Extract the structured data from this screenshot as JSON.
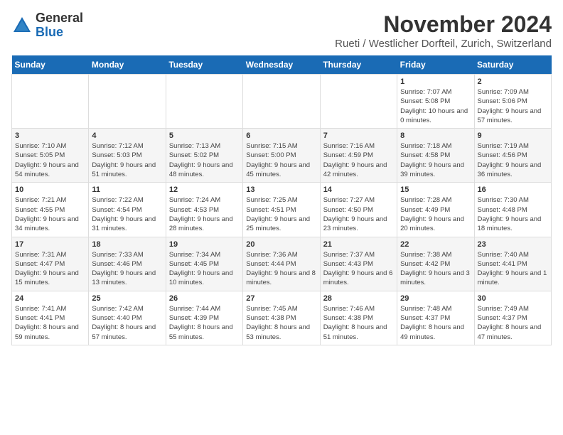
{
  "logo": {
    "general": "General",
    "blue": "Blue"
  },
  "header": {
    "title": "November 2024",
    "subtitle": "Rueti / Westlicher Dorfteil, Zurich, Switzerland"
  },
  "weekdays": [
    "Sunday",
    "Monday",
    "Tuesday",
    "Wednesday",
    "Thursday",
    "Friday",
    "Saturday"
  ],
  "rows": [
    [
      {
        "day": "",
        "info": ""
      },
      {
        "day": "",
        "info": ""
      },
      {
        "day": "",
        "info": ""
      },
      {
        "day": "",
        "info": ""
      },
      {
        "day": "",
        "info": ""
      },
      {
        "day": "1",
        "info": "Sunrise: 7:07 AM\nSunset: 5:08 PM\nDaylight: 10 hours and 0 minutes."
      },
      {
        "day": "2",
        "info": "Sunrise: 7:09 AM\nSunset: 5:06 PM\nDaylight: 9 hours and 57 minutes."
      }
    ],
    [
      {
        "day": "3",
        "info": "Sunrise: 7:10 AM\nSunset: 5:05 PM\nDaylight: 9 hours and 54 minutes."
      },
      {
        "day": "4",
        "info": "Sunrise: 7:12 AM\nSunset: 5:03 PM\nDaylight: 9 hours and 51 minutes."
      },
      {
        "day": "5",
        "info": "Sunrise: 7:13 AM\nSunset: 5:02 PM\nDaylight: 9 hours and 48 minutes."
      },
      {
        "day": "6",
        "info": "Sunrise: 7:15 AM\nSunset: 5:00 PM\nDaylight: 9 hours and 45 minutes."
      },
      {
        "day": "7",
        "info": "Sunrise: 7:16 AM\nSunset: 4:59 PM\nDaylight: 9 hours and 42 minutes."
      },
      {
        "day": "8",
        "info": "Sunrise: 7:18 AM\nSunset: 4:58 PM\nDaylight: 9 hours and 39 minutes."
      },
      {
        "day": "9",
        "info": "Sunrise: 7:19 AM\nSunset: 4:56 PM\nDaylight: 9 hours and 36 minutes."
      }
    ],
    [
      {
        "day": "10",
        "info": "Sunrise: 7:21 AM\nSunset: 4:55 PM\nDaylight: 9 hours and 34 minutes."
      },
      {
        "day": "11",
        "info": "Sunrise: 7:22 AM\nSunset: 4:54 PM\nDaylight: 9 hours and 31 minutes."
      },
      {
        "day": "12",
        "info": "Sunrise: 7:24 AM\nSunset: 4:53 PM\nDaylight: 9 hours and 28 minutes."
      },
      {
        "day": "13",
        "info": "Sunrise: 7:25 AM\nSunset: 4:51 PM\nDaylight: 9 hours and 25 minutes."
      },
      {
        "day": "14",
        "info": "Sunrise: 7:27 AM\nSunset: 4:50 PM\nDaylight: 9 hours and 23 minutes."
      },
      {
        "day": "15",
        "info": "Sunrise: 7:28 AM\nSunset: 4:49 PM\nDaylight: 9 hours and 20 minutes."
      },
      {
        "day": "16",
        "info": "Sunrise: 7:30 AM\nSunset: 4:48 PM\nDaylight: 9 hours and 18 minutes."
      }
    ],
    [
      {
        "day": "17",
        "info": "Sunrise: 7:31 AM\nSunset: 4:47 PM\nDaylight: 9 hours and 15 minutes."
      },
      {
        "day": "18",
        "info": "Sunrise: 7:33 AM\nSunset: 4:46 PM\nDaylight: 9 hours and 13 minutes."
      },
      {
        "day": "19",
        "info": "Sunrise: 7:34 AM\nSunset: 4:45 PM\nDaylight: 9 hours and 10 minutes."
      },
      {
        "day": "20",
        "info": "Sunrise: 7:36 AM\nSunset: 4:44 PM\nDaylight: 9 hours and 8 minutes."
      },
      {
        "day": "21",
        "info": "Sunrise: 7:37 AM\nSunset: 4:43 PM\nDaylight: 9 hours and 6 minutes."
      },
      {
        "day": "22",
        "info": "Sunrise: 7:38 AM\nSunset: 4:42 PM\nDaylight: 9 hours and 3 minutes."
      },
      {
        "day": "23",
        "info": "Sunrise: 7:40 AM\nSunset: 4:41 PM\nDaylight: 9 hours and 1 minute."
      }
    ],
    [
      {
        "day": "24",
        "info": "Sunrise: 7:41 AM\nSunset: 4:41 PM\nDaylight: 8 hours and 59 minutes."
      },
      {
        "day": "25",
        "info": "Sunrise: 7:42 AM\nSunset: 4:40 PM\nDaylight: 8 hours and 57 minutes."
      },
      {
        "day": "26",
        "info": "Sunrise: 7:44 AM\nSunset: 4:39 PM\nDaylight: 8 hours and 55 minutes."
      },
      {
        "day": "27",
        "info": "Sunrise: 7:45 AM\nSunset: 4:38 PM\nDaylight: 8 hours and 53 minutes."
      },
      {
        "day": "28",
        "info": "Sunrise: 7:46 AM\nSunset: 4:38 PM\nDaylight: 8 hours and 51 minutes."
      },
      {
        "day": "29",
        "info": "Sunrise: 7:48 AM\nSunset: 4:37 PM\nDaylight: 8 hours and 49 minutes."
      },
      {
        "day": "30",
        "info": "Sunrise: 7:49 AM\nSunset: 4:37 PM\nDaylight: 8 hours and 47 minutes."
      }
    ]
  ]
}
